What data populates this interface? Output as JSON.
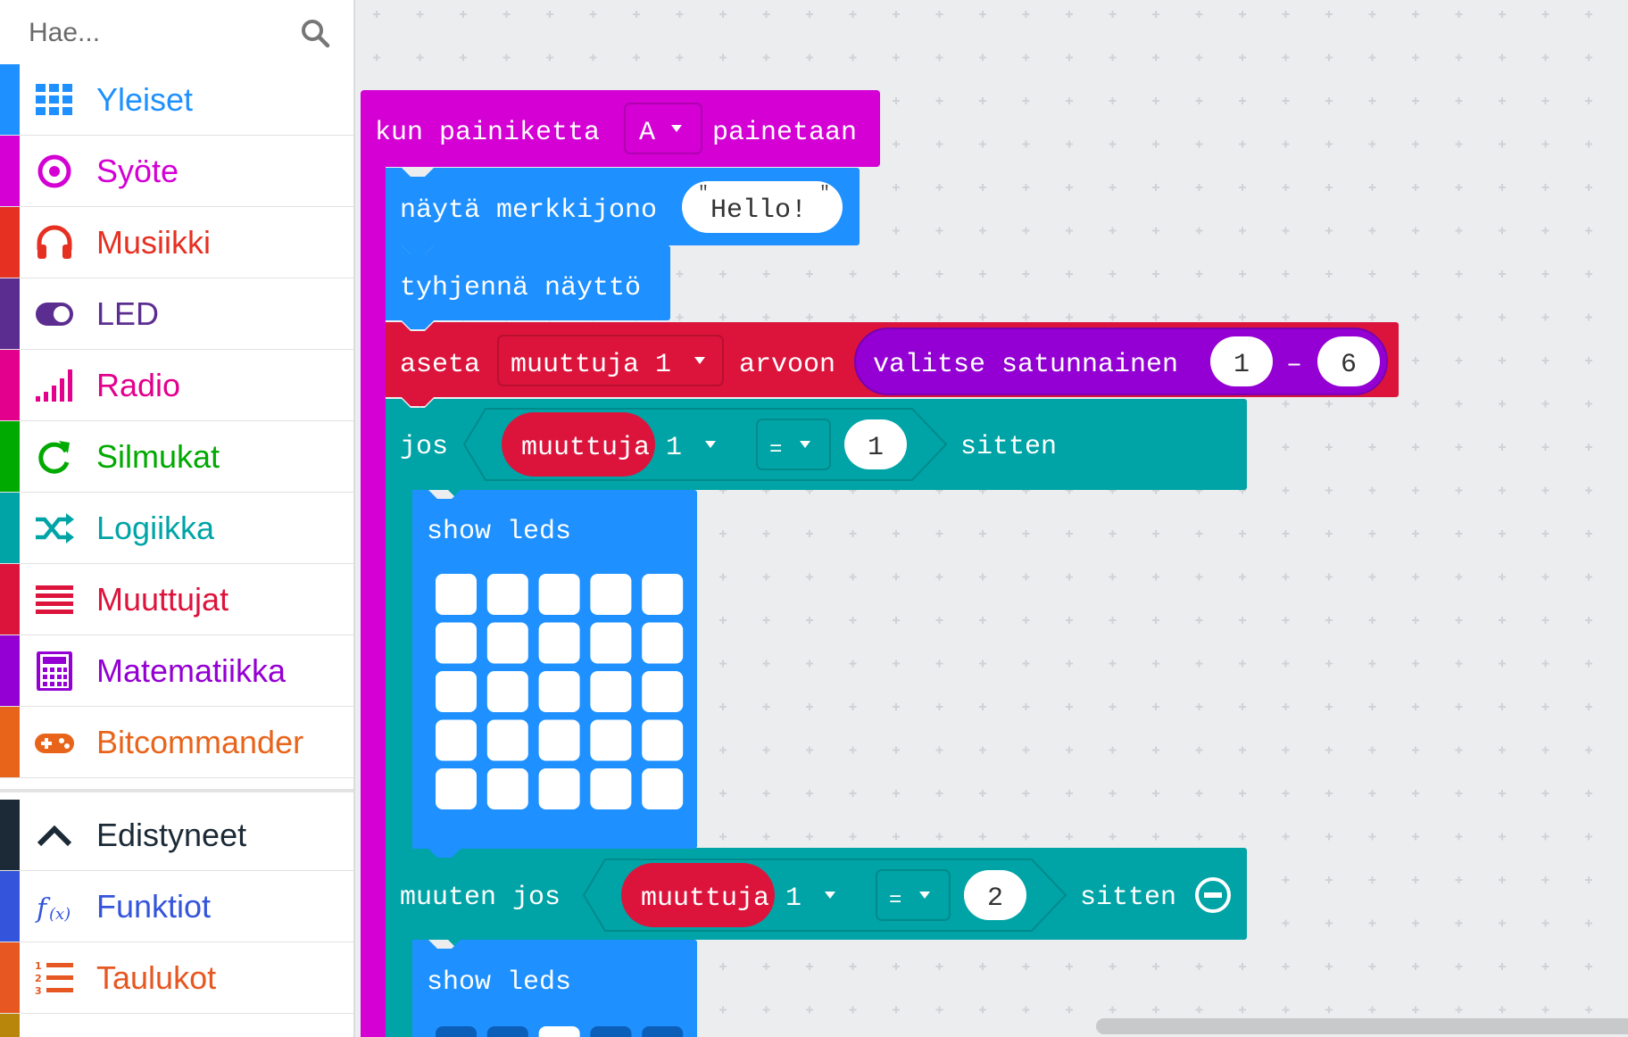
{
  "search": {
    "placeholder": "Hae..."
  },
  "categories": [
    {
      "label": "Yleiset",
      "color": "#1e90ff",
      "icon": "grid-icon"
    },
    {
      "label": "Syöte",
      "color": "#d400d4",
      "icon": "target-icon"
    },
    {
      "label": "Musiikki",
      "color": "#e63022",
      "icon": "headphones-icon"
    },
    {
      "label": "LED",
      "color": "#5c2d91",
      "icon": "toggle-icon"
    },
    {
      "label": "Radio",
      "color": "#e3008c",
      "icon": "signal-bars-icon"
    },
    {
      "label": "Silmukat",
      "color": "#00aa00",
      "icon": "refresh-icon"
    },
    {
      "label": "Logiikka",
      "color": "#00a4a6",
      "icon": "shuffle-icon"
    },
    {
      "label": "Muuttujat",
      "color": "#dc143c",
      "icon": "list-lines-icon"
    },
    {
      "label": "Matematiikka",
      "color": "#9400d3",
      "icon": "calculator-icon"
    },
    {
      "label": "Bitcommander",
      "color": "#e8641b",
      "icon": "gamepad-icon"
    }
  ],
  "advanced": [
    {
      "label": "Edistyneet",
      "color": "#1b2a36",
      "icon": "chevron-up-icon"
    },
    {
      "label": "Funktiot",
      "color": "#3455db",
      "icon": "function-icon"
    },
    {
      "label": "Taulukot",
      "color": "#e65722",
      "icon": "numbered-list-icon"
    }
  ],
  "blocks": {
    "event": {
      "prefix": "kun painiketta",
      "button": "A",
      "suffix": "painetaan",
      "color": "#d400d4"
    },
    "show_string": {
      "label": "näytä merkkijono",
      "value": "Hello!",
      "color": "#1e90ff"
    },
    "clear_screen": {
      "label": "tyhjennä näyttö"
    },
    "set_var": {
      "prefix": "aseta",
      "variable": "muuttuja 1",
      "middle": "arvoon",
      "color": "#dc143c"
    },
    "random": {
      "label": "valitse satunnainen",
      "from": "1",
      "sep": "–",
      "to": "6",
      "color": "#9400d3"
    },
    "if": {
      "prefix": "jos",
      "variable": "muuttuja 1",
      "op": "=",
      "value": "1",
      "suffix": "sitten",
      "color": "#00a4a6"
    },
    "show_leds_1": {
      "label": "show leds"
    },
    "else_if": {
      "prefix": "muuten jos",
      "variable": "muuttuja 1",
      "op": "=",
      "value": "2",
      "suffix": "sitten"
    },
    "show_leds_2": {
      "label": "show leds"
    }
  }
}
